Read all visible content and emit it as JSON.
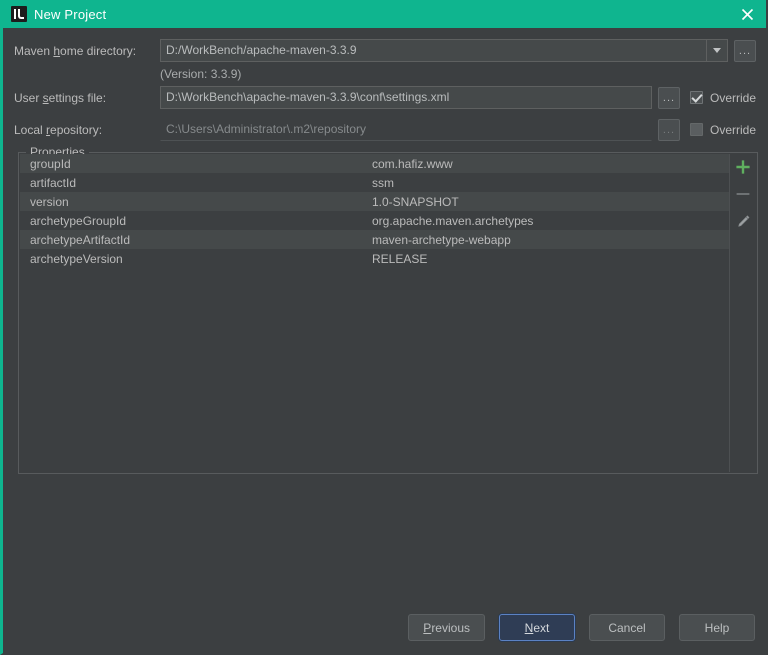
{
  "titlebar": {
    "icon": "intellij-logo-icon",
    "title": "New Project",
    "close_label": "close-icon"
  },
  "form": {
    "maven_home": {
      "label_pre": "Maven ",
      "label_mnemonic": "h",
      "label_post": "ome directory:",
      "value": "D:/WorkBench/apache-maven-3.3.9",
      "dropdown_icon": "chevron-down-icon",
      "browse_label": "...",
      "version_note": "(Version: 3.3.9)"
    },
    "user_settings": {
      "label_pre": "User ",
      "label_mnemonic": "s",
      "label_post": "ettings file:",
      "value": "D:\\WorkBench\\apache-maven-3.3.9\\conf\\settings.xml",
      "browse_label": "...",
      "override_label": "Override",
      "override_checked": true
    },
    "local_repository": {
      "label_pre": "Local ",
      "label_mnemonic": "r",
      "label_post": "epository:",
      "value": "C:\\Users\\Administrator\\.m2\\repository",
      "browse_label": "...",
      "override_label": "Override",
      "override_checked": false
    }
  },
  "properties": {
    "legend": "Properties",
    "rows": [
      {
        "key": "groupId",
        "value": "com.hafiz.www"
      },
      {
        "key": "artifactId",
        "value": "ssm"
      },
      {
        "key": "version",
        "value": "1.0-SNAPSHOT"
      },
      {
        "key": "archetypeGroupId",
        "value": "org.apache.maven.archetypes"
      },
      {
        "key": "archetypeArtifactId",
        "value": "maven-archetype-webapp"
      },
      {
        "key": "archetypeVersion",
        "value": "RELEASE"
      }
    ],
    "toolbar": [
      {
        "name": "add-property-button",
        "icon": "plus-icon"
      },
      {
        "name": "remove-property-button",
        "icon": "minus-icon"
      },
      {
        "name": "edit-property-button",
        "icon": "pencil-icon"
      }
    ]
  },
  "footer": {
    "previous": {
      "pre": "",
      "mnemonic": "P",
      "post": "revious"
    },
    "next": {
      "pre": "",
      "mnemonic": "N",
      "post": "ext"
    },
    "cancel": {
      "pre": "",
      "mnemonic": "",
      "post": "Cancel"
    },
    "help": {
      "pre": "",
      "mnemonic": "",
      "post": "Help"
    }
  },
  "colors": {
    "accent": "#0fb58f",
    "background": "#3c3f41",
    "field": "#45494a",
    "row_stripe": "#45494a",
    "default_button": "#2f3d55",
    "default_button_border": "#5b82c4",
    "add_icon": "#5faf5f"
  }
}
